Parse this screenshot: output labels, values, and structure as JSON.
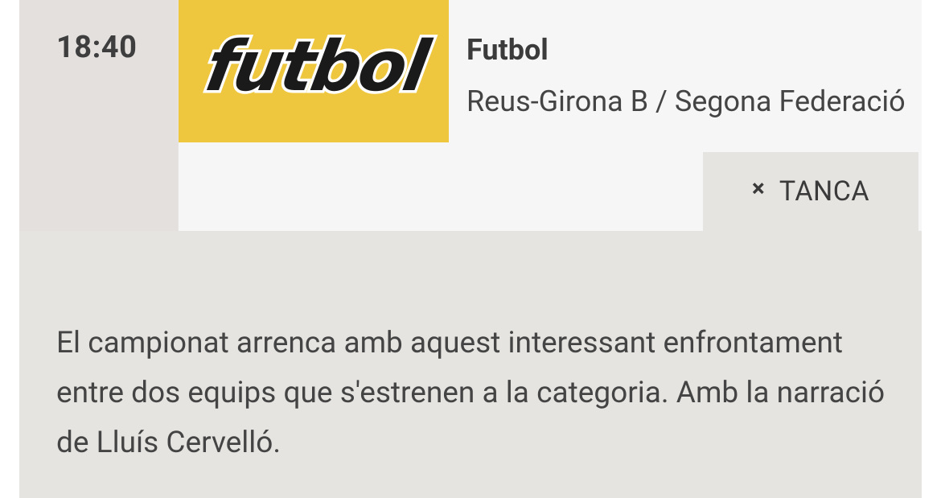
{
  "program": {
    "time": "18:40",
    "thumbnail_logo_text": "futbol",
    "title": "Futbol",
    "subtitle": "Reus-Girona B / Segona Federació",
    "description": "El campionat arrenca amb aquest interessant enfrontament entre dos equips que s'estrenen a la categoria. Amb la narració de Lluís Cervelló."
  },
  "close_button": {
    "icon": "close-icon",
    "label": "TANCA"
  },
  "colors": {
    "thumbnail_background": "#eec73f",
    "card_background": "#e6e4e1",
    "panel_background": "#f6f6f6"
  }
}
